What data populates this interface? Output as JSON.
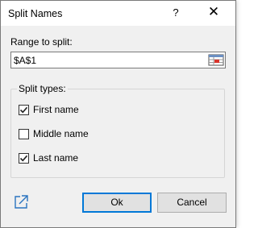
{
  "window": {
    "title": "Split Names",
    "help_glyph": "?",
    "close_glyph": "✕"
  },
  "range": {
    "label": "Range to split:",
    "value": "$A$1",
    "picker_icon": "range-select-icon"
  },
  "split_types": {
    "legend": "Split types:",
    "options": [
      {
        "label": "First name",
        "checked": true
      },
      {
        "label": "Middle name",
        "checked": false
      },
      {
        "label": "Last name",
        "checked": true
      }
    ]
  },
  "footer": {
    "link_icon": "external-link-icon",
    "ok_label": "Ok",
    "cancel_label": "Cancel"
  },
  "colors": {
    "accent": "#0078d7",
    "link_icon": "#2a74c0",
    "picker_red": "#d9342b"
  }
}
